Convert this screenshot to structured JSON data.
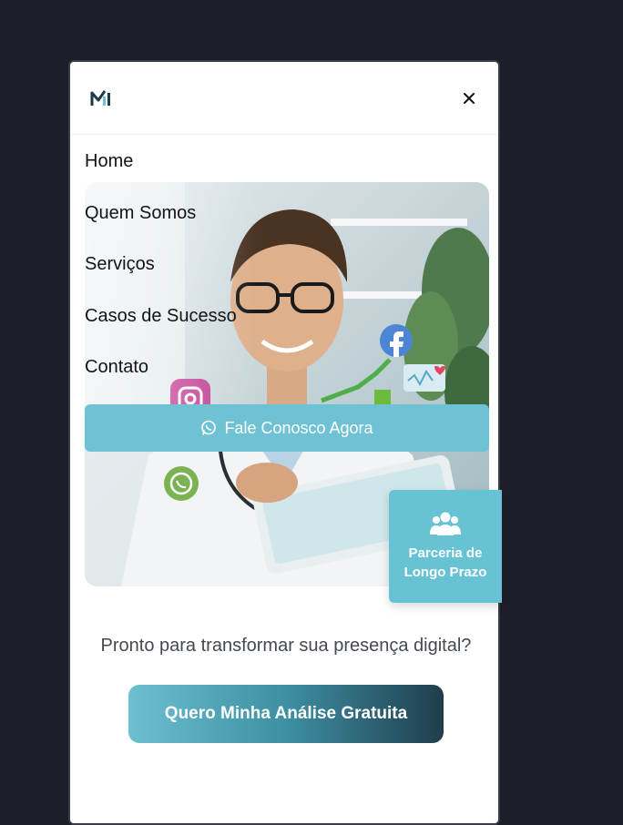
{
  "header": {
    "logo_icon": "brand-logo-icon",
    "close_icon": "close-icon"
  },
  "nav": {
    "items": [
      {
        "label": "Home"
      },
      {
        "label": "Quem Somos"
      },
      {
        "label": "Serviços"
      },
      {
        "label": "Casos de Sucesso"
      },
      {
        "label": "Contato"
      }
    ]
  },
  "hero": {
    "image": "doctor-with-tablet-photo",
    "social_icons": [
      "facebook-icon",
      "instagram-icon",
      "whatsapp-icon",
      "heart-chart-icon"
    ]
  },
  "whatsapp_cta": {
    "label": "Fale Conosco Agora",
    "icon": "whatsapp-icon"
  },
  "badge": {
    "icon": "users-icon",
    "label_line1": "Parceria de",
    "label_line2": "Longo Prazo"
  },
  "prompt": {
    "text": "Pronto para transformar sua presença digital?"
  },
  "main_cta": {
    "label": "Quero Minha Análise Gratuita"
  },
  "colors": {
    "background": "#1c1f2a",
    "accent": "#6ec2d3",
    "cta_gradient_start": "#6cc0d0",
    "cta_gradient_end": "#1f3e4c"
  }
}
